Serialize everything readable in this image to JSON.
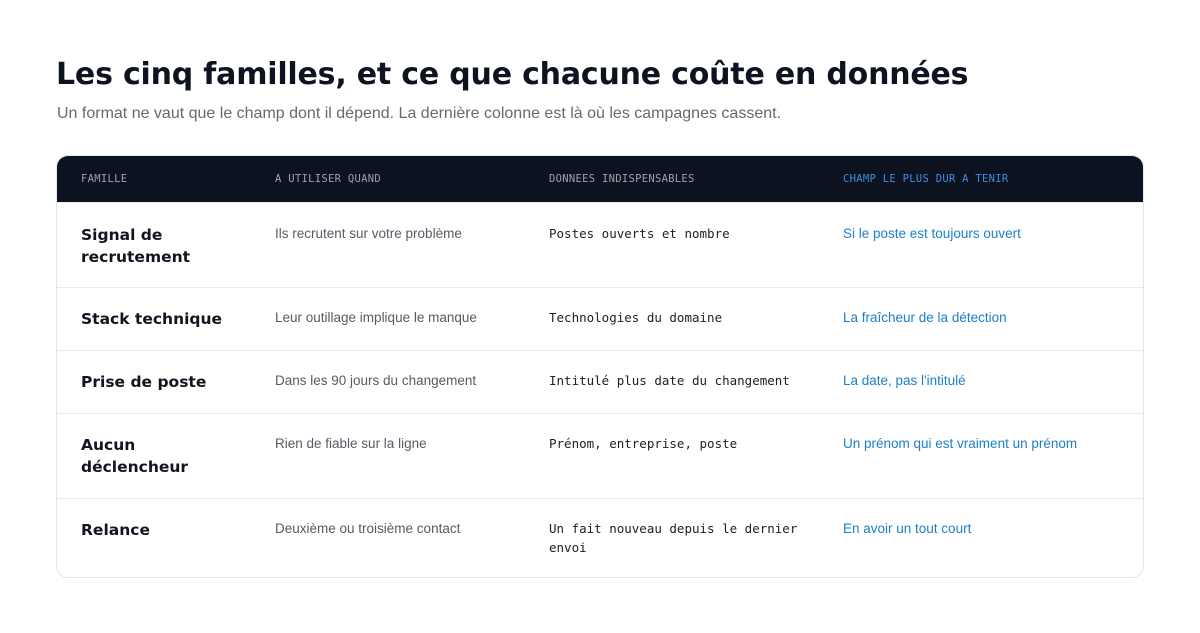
{
  "header": {
    "title": "Les cinq familles, et ce que chacune coûte en données",
    "subtitle": "Un format ne vaut que le champ dont il dépend. La dernière colonne est là où les campagnes cassent."
  },
  "table": {
    "columns": [
      "FAMILLE",
      "A UTILISER QUAND",
      "DONNEES INDISPENSABLES",
      "CHAMP LE PLUS DUR A TENIR"
    ],
    "rows": [
      {
        "famille": "Signal de recrutement",
        "quand": "Ils recrutent sur votre problème",
        "donnees": "Postes ouverts et nombre",
        "champ": "Si le poste est toujours ouvert"
      },
      {
        "famille": "Stack technique",
        "quand": "Leur outillage implique le manque",
        "donnees": "Technologies du domaine",
        "champ": "La fraîcheur de la détection"
      },
      {
        "famille": "Prise de poste",
        "quand": "Dans les 90 jours du changement",
        "donnees": "Intitulé plus date du changement",
        "champ": "La date, pas l'intitulé"
      },
      {
        "famille": "Aucun déclencheur",
        "quand": "Rien de fiable sur la ligne",
        "donnees": "Prénom, entreprise, poste",
        "champ": "Un prénom qui est vraiment un prénom"
      },
      {
        "famille": "Relance",
        "quand": "Deuxième ou troisième contact",
        "donnees": "Un fait nouveau depuis le dernier envoi",
        "champ": "En avoir un tout court"
      }
    ]
  },
  "colors": {
    "header_bg": "#0c1220",
    "accent": "#1d7fc7",
    "accent_header": "#3d8fe0",
    "muted_text": "#626a75"
  }
}
